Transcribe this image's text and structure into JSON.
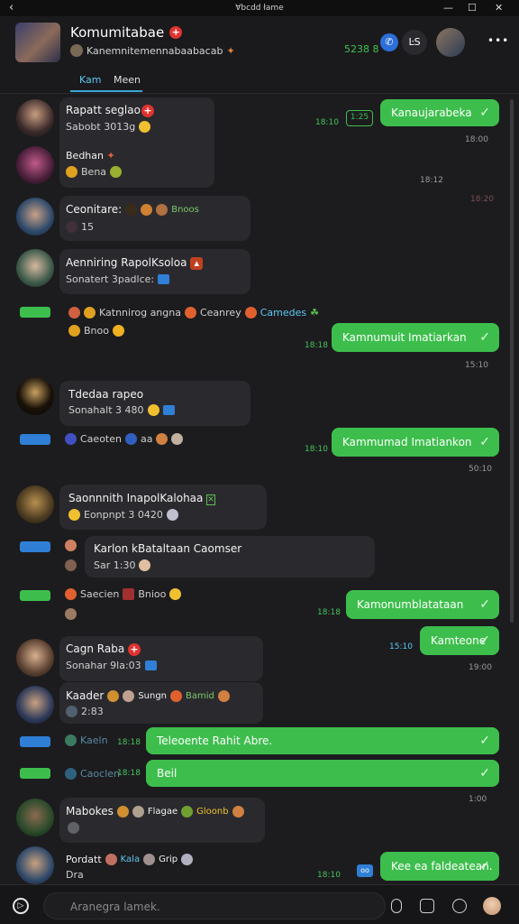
{
  "window": {
    "title": "Ɐbcdd łame",
    "back": "‹",
    "minimize": "—",
    "maximize": "☐",
    "close": "✕"
  },
  "header": {
    "title": "Komumitabae",
    "subtitle": "Kanemnitemennabaabacab",
    "count": "5238 8",
    "tabs": [
      "Kam",
      "Meen"
    ],
    "menu": "•••",
    "icon_label": "ĿS"
  },
  "messages": [
    {
      "name": "Rapatt seglao",
      "text": "Sabobt 3013g",
      "time": "18:10",
      "badge": "1:25"
    },
    {
      "name": "Bedhan",
      "text": "Bena"
    },
    {
      "name": "Ceonitare:",
      "text": "15",
      "extra": "Bnoos"
    },
    {
      "name": "Aenniring RapolKsoloa",
      "text": "Sonatert 3padlce:"
    },
    {
      "name": "Katnnirog angna",
      "extra1": "Ceanrey",
      "extra2": "Camedes",
      "text": "Bnoo"
    },
    {
      "name": "Tdedaa rapeo",
      "text": "Sonahalt 3 480"
    },
    {
      "name": "Caeoten",
      "text": "aa"
    },
    {
      "name": "Saonnnith InapolKalohaa",
      "text": "Eonpnpt 3 0420"
    },
    {
      "name": "Karlon kBataltaan Caomser",
      "text": "Sar 1:30"
    },
    {
      "name": "Saecien",
      "text": "Bnioo"
    },
    {
      "name": "Cagn Raba",
      "text": "Sonahar 9la:03"
    },
    {
      "name": "Kaader",
      "extra1": "Sungn",
      "extra2": "Bamid",
      "text": "2:83"
    },
    {
      "name": "Kaeln"
    },
    {
      "name": "Caoclen"
    },
    {
      "name": "Mabokes",
      "extra1": "Flagae",
      "extra2": "Gloonb"
    },
    {
      "name": "Pordatt",
      "extra1": "Kala",
      "extra2": "Grip",
      "text": "Dra"
    }
  ],
  "outgoing": [
    {
      "text": "Kanaujarabeka",
      "time": "18:00"
    },
    {
      "text": "Kamnumuit Imatiarkan",
      "time": "15:10",
      "stamp": "18:18"
    },
    {
      "text": "Kammumad Imatiankon",
      "time": "50:10",
      "stamp": "18:10"
    },
    {
      "text": "Kamonumblatataan",
      "stamp": "18:18"
    },
    {
      "text": "Kamteone",
      "time": "19:00",
      "stamp": "15:10"
    },
    {
      "text": "Teleoente Rahit Abre.",
      "stamp": "18:18"
    },
    {
      "text": "Beil",
      "time": "1:00",
      "stamp": "18:18"
    },
    {
      "text": "Kee ea faldeatean.",
      "stamp": "18:10"
    }
  ],
  "misc": {
    "t1": "18:12",
    "t2": "18:20"
  },
  "input": {
    "placeholder": "Aranegra lamek."
  },
  "colors": {
    "green": "#3dbe4c",
    "blue": "#2f7fd6",
    "red": "#e0332f",
    "bg": "#1c1c1f"
  }
}
